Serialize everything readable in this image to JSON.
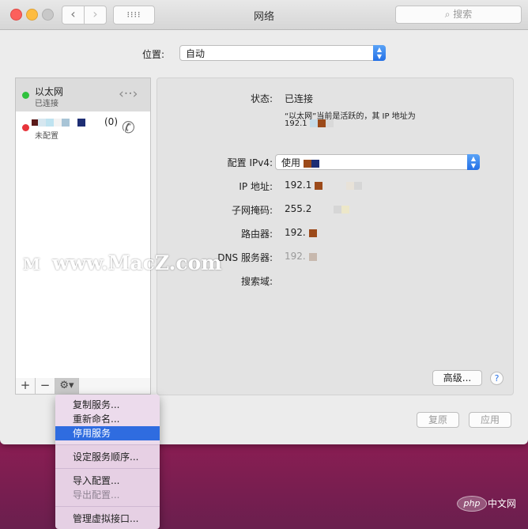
{
  "window": {
    "title": "网络",
    "search_placeholder": "搜索",
    "grid_label": "⁝⁝⁝⁝"
  },
  "location": {
    "label": "位置:",
    "value": "自动"
  },
  "services": [
    {
      "name": "以太网",
      "status": "已连接",
      "dot_color": "#2fc13d",
      "icon": "ethernet-arrows-icon"
    },
    {
      "name": "(0)",
      "status": "未配置",
      "dot_color": "#e7343b",
      "icon": "phone-modem-icon"
    }
  ],
  "sidebar_tools": {
    "add": "+",
    "remove": "−",
    "gear": "⚙▾"
  },
  "details": {
    "status_label": "状态:",
    "status_value": "已连接",
    "status_desc_1": "“以太网”当前是活跃的，其 IP 地址为",
    "status_desc_2": "192.1",
    "ipv4_label": "配置 IPv4:",
    "ipv4_value": "使用",
    "ip_label": "IP 地址:",
    "ip_value": "192.1",
    "mask_label": "子网掩码:",
    "mask_value": "255.2",
    "router_label": "路由器:",
    "router_value": "192.",
    "dns_label": "DNS 服务器:",
    "dns_value": "192.",
    "search_domain_label": "搜索域:"
  },
  "buttons": {
    "advanced": "高级...",
    "help": "?",
    "revert": "复原",
    "apply": "应用"
  },
  "context_menu": {
    "items": [
      {
        "label": "复制服务...",
        "state": "normal"
      },
      {
        "label": "重新命名...",
        "state": "normal"
      },
      {
        "label": "停用服务",
        "state": "selected"
      },
      {
        "label": "设定服务顺序...",
        "state": "normal"
      },
      {
        "label": "导入配置...",
        "state": "normal"
      },
      {
        "label": "导出配置...",
        "state": "disabled"
      },
      {
        "label": "管理虚拟接口...",
        "state": "normal"
      }
    ]
  },
  "watermark": {
    "logo": "M",
    "text": "www.MacZ.com"
  },
  "php_badge": {
    "logo": "php",
    "text": "中文网"
  }
}
